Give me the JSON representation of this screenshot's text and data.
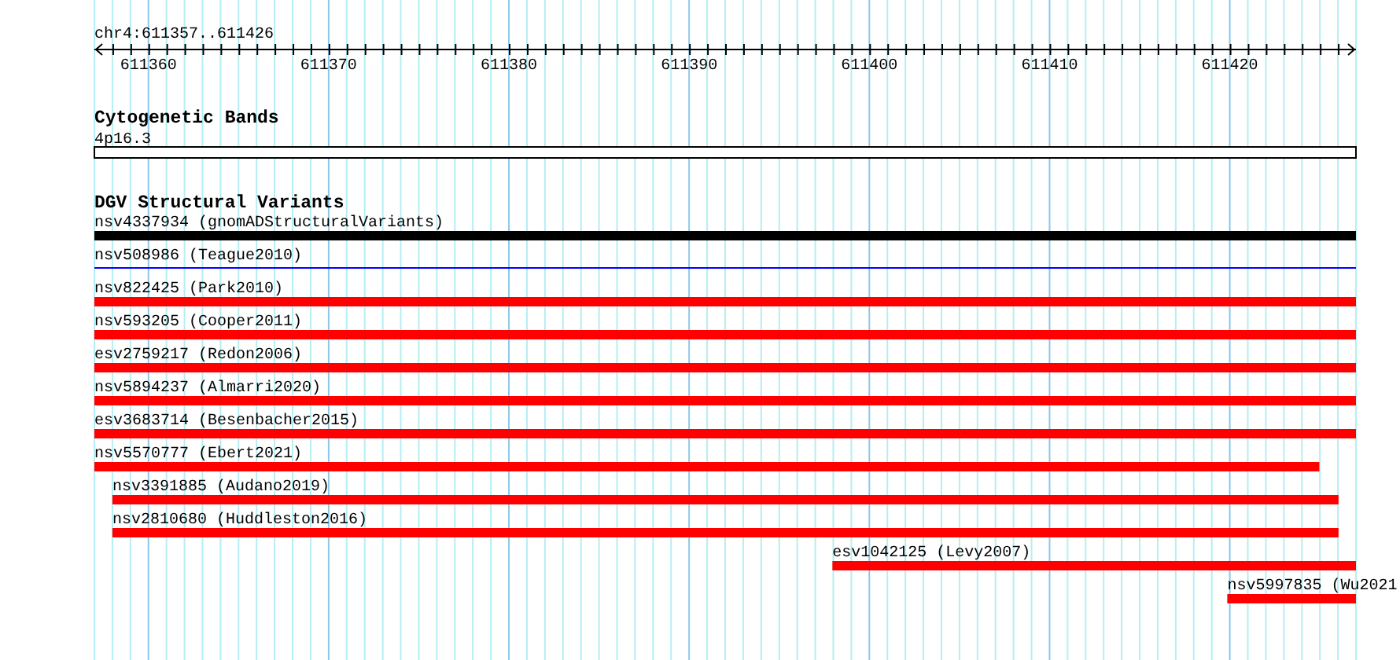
{
  "position": "chr4:611357..611426",
  "ruler": {
    "ticks": [
      "611360",
      "611370",
      "611380",
      "611390",
      "611400",
      "611410",
      "611420"
    ]
  },
  "cytogenetic_bands": {
    "title": "Cytogenetic Bands",
    "band": "4p16.3"
  },
  "dgv_track": {
    "title": "DGV Structural Variants",
    "features": [
      {
        "label": "nsv4337934 (gnomADStructuralVariants)",
        "kind": "bar",
        "color": "#000000",
        "level": 1
      },
      {
        "label": "nsv508986 (Teague2010)",
        "kind": "line",
        "color": "#0000ff",
        "level": 1
      },
      {
        "label": "nsv822425 (Park2010)",
        "kind": "bar",
        "color": "#ff0000",
        "level": 1
      },
      {
        "label": "nsv593205 (Cooper2011)",
        "kind": "bar",
        "color": "#ff0000",
        "level": 1
      },
      {
        "label": "esv2759217 (Redon2006)",
        "kind": "bar",
        "color": "#ff0000",
        "level": 1
      },
      {
        "label": "nsv5894237 (Almarri2020)",
        "kind": "bar",
        "color": "#ff0000",
        "level": 1
      },
      {
        "label": "esv3683714 (Besenbacher2015)",
        "kind": "bar",
        "color": "#ff0000",
        "level": 1
      },
      {
        "label": "nsv5570777 (Ebert2021)",
        "kind": "bar",
        "color": "#ff0000",
        "level": 0.971
      },
      {
        "label": "nsv3391885 (Audano2019)",
        "kind": "insetbar",
        "color": "#ff0000",
        "level": 0.986
      },
      {
        "label": "nsv2810680 (Huddleston2016)",
        "kind": "insetbar",
        "color": "#ff0000",
        "level": 0.986
      },
      {
        "label": "esv1042125 (Levy2007)",
        "kind": "endbar",
        "color": "#ff0000",
        "level": 0.415
      },
      {
        "label": "nsv5997835 (Wu2021",
        "kind": "endbar",
        "color": "#ff0000",
        "level": 0.102
      }
    ]
  }
}
